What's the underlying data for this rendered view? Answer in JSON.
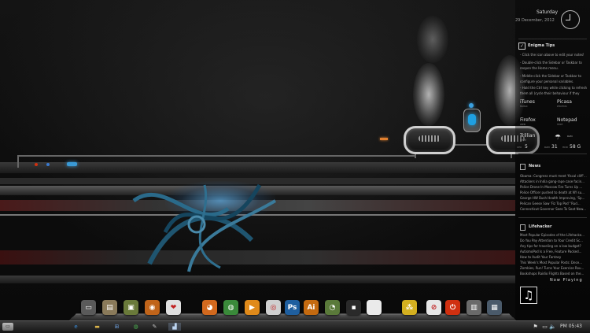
{
  "sidebar": {
    "day": "Saturday",
    "date": "29 December, 2012",
    "tips_title": "Enigma Tips",
    "tips": [
      "- Click the icon above to edit your notes!",
      "- Double-click the Sidebar or Taskbar to reopen the Home menu.",
      "- Middle-click the Sidebar or Taskbar to configure your personal variables.",
      "- Hold the Ctrl key while clicking to refresh them all (cycle their behaviour if they have any)."
    ],
    "shortcuts": [
      {
        "label": "iTunes",
        "sub": "MUSIC"
      },
      {
        "label": "Picasa",
        "sub": "PHOTOS"
      },
      {
        "label": "Firefox",
        "sub": "WEB"
      },
      {
        "label": "Notepad",
        "sub": "TEXT"
      },
      {
        "label": "Trillian",
        "sub": "CHAT"
      }
    ],
    "ram_label": "RAM",
    "cpu_label": "CPU",
    "cpu_value": "5",
    "ram_value": "31",
    "hdd_label": "HDD",
    "hdd_value": "58 G",
    "news_title": "News",
    "news": [
      "Obama: Congress must meet 'fiscal cliff'...",
      "Attackers in India gang-rape case facin...",
      "Police Drone In Moscow Fire Turns Up ...",
      "Police Officer pushed to death at NY su...",
      "George HW Bush Health Improving, 'Sp...",
      "Pelican Geese Saw 'Fiz Top Pod' 'Rud...",
      "Connecticut Governor Sees To Seat New..."
    ],
    "lifehacker_title": "Lifehacker",
    "lifehacker": [
      "Most Popular Episodes of the Lifehacke...",
      "Do You Pay Attention to Your Credit Sc...",
      "Any tips for traveling on a low budget?",
      "AutismoPod Is a Free, Feature Packed...",
      "How to Audit Your Fantasy",
      "This Week's Most Popular Posts: Dece...",
      "Zombies, Run! Turns Your Exercise Rou...",
      "Bookshops Raidio Flights Based on the..."
    ],
    "now_playing_label": "Now Playing",
    "music_note": "♫"
  },
  "dock": {
    "icons": [
      {
        "name": "Computer",
        "color": "#5a5a5a",
        "glyph": "▭"
      },
      {
        "name": "Documents",
        "color": "#8a7a5a",
        "glyph": "▤"
      },
      {
        "name": "Pictures",
        "color": "#6a7a3a",
        "glyph": "▣"
      },
      {
        "name": "Music",
        "color": "#c0641a",
        "glyph": "◉"
      },
      {
        "name": "Favorites",
        "color": "#e0e0e0",
        "glyph": "❤"
      },
      {
        "name": "Firefox",
        "color": "#d2691e",
        "glyph": "◕"
      },
      {
        "name": "Chrome",
        "color": "#3a8a3a",
        "glyph": "◍"
      },
      {
        "name": "Media Player",
        "color": "#e08a1a",
        "glyph": "▶"
      },
      {
        "name": "Disc",
        "color": "#cfcfcf",
        "glyph": "◎"
      },
      {
        "name": "Photoshop",
        "color": "#1f5f9f",
        "glyph": "Ps"
      },
      {
        "name": "Illustrator",
        "color": "#c46a10",
        "glyph": "Ai"
      },
      {
        "name": "Utility",
        "color": "#5a7a3a",
        "glyph": "◔"
      },
      {
        "name": "Console",
        "color": "#2a2a2a",
        "glyph": "▪"
      },
      {
        "name": "Notes",
        "color": "#eaeaea",
        "glyph": ""
      },
      {
        "name": "Media Center",
        "color": "#d4b020",
        "glyph": "⁂"
      },
      {
        "name": "No Entry",
        "color": "#e6e6e6",
        "glyph": "⊘"
      },
      {
        "name": "Power",
        "color": "#d03010",
        "glyph": "⏻"
      },
      {
        "name": "Trash",
        "color": "#6a6a6a",
        "glyph": "▥"
      },
      {
        "name": "Archive",
        "color": "#4a5a6a",
        "glyph": "▦"
      }
    ]
  },
  "taskbar": {
    "start_glyph": "▭",
    "apps": [
      {
        "name": "Internet Explorer",
        "glyph": "e",
        "color": "#3a8ad6"
      },
      {
        "name": "Explorer",
        "glyph": "▬",
        "color": "#d8b24a"
      },
      {
        "name": "Windows",
        "glyph": "⊞",
        "color": "#6a9ad6"
      },
      {
        "name": "Chrome",
        "glyph": "◍",
        "color": "#4caf50"
      },
      {
        "name": "Paint",
        "glyph": "✎",
        "color": "#c0c0c0"
      },
      {
        "name": "Active App",
        "glyph": "▟",
        "color": "#bcd4f0"
      }
    ],
    "tray": {
      "flag": "⚑",
      "monitor": "▭",
      "volume": "🔈",
      "time": "PM 05:43"
    }
  }
}
